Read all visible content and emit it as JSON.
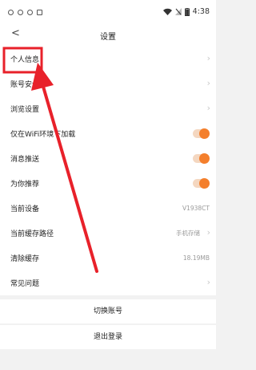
{
  "status": {
    "time": "4:38"
  },
  "nav": {
    "back_glyph": "<",
    "title": "设置"
  },
  "settings": [
    {
      "label": "个人信息",
      "control": "chevron"
    },
    {
      "label": "账号安全",
      "control": "chevron"
    },
    {
      "label": "浏览设置",
      "control": "chevron"
    },
    {
      "label": "仅在WiFi环境下加载",
      "control": "toggle",
      "on": true
    },
    {
      "label": "消息推送",
      "control": "toggle",
      "on": true
    },
    {
      "label": "为你推荐",
      "control": "toggle",
      "on": true
    },
    {
      "label": "当前设备",
      "control": "value",
      "value": "V1938CT"
    },
    {
      "label": "当前缓存路径",
      "control": "value_chevron",
      "value": "手机存储"
    },
    {
      "label": "清除缓存",
      "control": "value",
      "value": "18.19MB"
    },
    {
      "label": "常见问题",
      "control": "chevron"
    }
  ],
  "actions": {
    "switch_account": "切换账号",
    "logout": "退出登录"
  },
  "colors": {
    "accent": "#f47f2c",
    "highlight": "#e8212a"
  }
}
